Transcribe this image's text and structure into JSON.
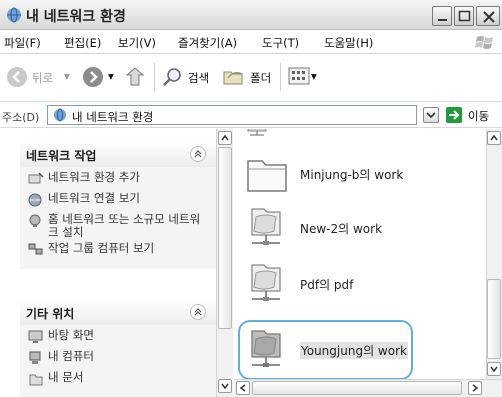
{
  "window": {
    "title": "내 네트워크 환경",
    "icon": "network-places-icon"
  },
  "menu": {
    "items": [
      "파일(F)",
      "편집(E)",
      "보기(V)",
      "즐겨찾기(A)",
      "도구(T)",
      "도움말(H)"
    ]
  },
  "toolbar": {
    "back_label": "뒤로",
    "search_label": "검색",
    "folders_label": "폴더"
  },
  "address": {
    "label": "주소(D)",
    "value": "내 네트워크 환경",
    "go_label": "이동"
  },
  "left_panel": {
    "network_tasks": {
      "title": "네트워크 작업",
      "items": [
        {
          "label": "네트워크 환경 추가",
          "icon": "add-network-place-icon"
        },
        {
          "label": "네트워크 연결 보기",
          "icon": "network-connections-icon"
        },
        {
          "label": "홈 네트워크 또는 소규모 네트워크 설치",
          "icon": "home-network-setup-icon"
        },
        {
          "label": "작업 그룹 컴퓨터 보기",
          "icon": "workgroup-computers-icon"
        }
      ]
    },
    "other_places": {
      "title": "기타 위치",
      "items": [
        {
          "label": "바탕 화면",
          "icon": "desktop-icon"
        },
        {
          "label": "내 컴퓨터",
          "icon": "my-computer-icon"
        },
        {
          "label": "내 문서",
          "icon": "my-documents-icon"
        }
      ]
    }
  },
  "content": {
    "items": [
      {
        "label": "Minjung-b의 work",
        "icon": "folder-icon"
      },
      {
        "label": "New-2의 work",
        "icon": "network-folder-icon"
      },
      {
        "label": "Pdf의 pdf",
        "icon": "network-folder-icon"
      },
      {
        "label": "Youngjung의 work",
        "icon": "network-folder-icon",
        "selected": true
      }
    ]
  },
  "colors": {
    "highlight_ring": "#5fb0e0",
    "go_button": "#1f9b3a",
    "address_border": "#7f9db9"
  }
}
